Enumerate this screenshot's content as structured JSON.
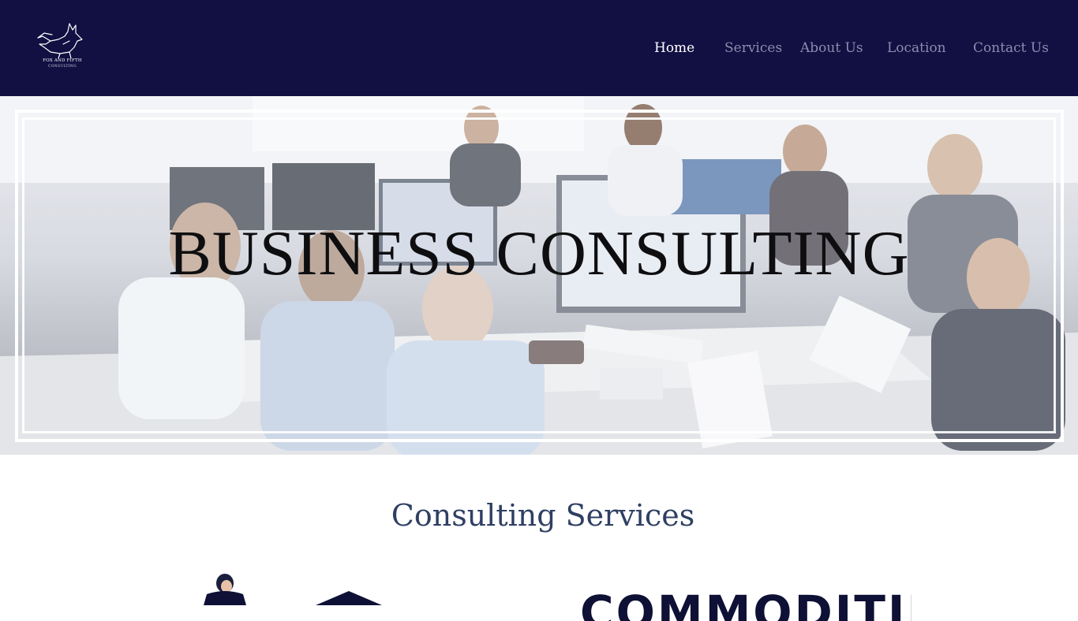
{
  "brand": {
    "name": "FOX AND FIFTH",
    "tagline": "CONSULTING"
  },
  "nav": {
    "items": [
      {
        "label": "Home",
        "active": true
      },
      {
        "label": "Services",
        "active": false
      },
      {
        "label": "About Us",
        "active": false
      },
      {
        "label": "Location",
        "active": false
      },
      {
        "label": "Contact Us",
        "active": false
      }
    ]
  },
  "hero": {
    "title": "BUSINESS CONSULTING"
  },
  "services": {
    "title": "Consulting Services",
    "first_card_heading": "COMMODITIES"
  },
  "colors": {
    "header_bg": "#120f42",
    "nav_active": "#ffffff",
    "nav_inactive": "#8e8bb0",
    "section_title": "#2f3f63"
  }
}
